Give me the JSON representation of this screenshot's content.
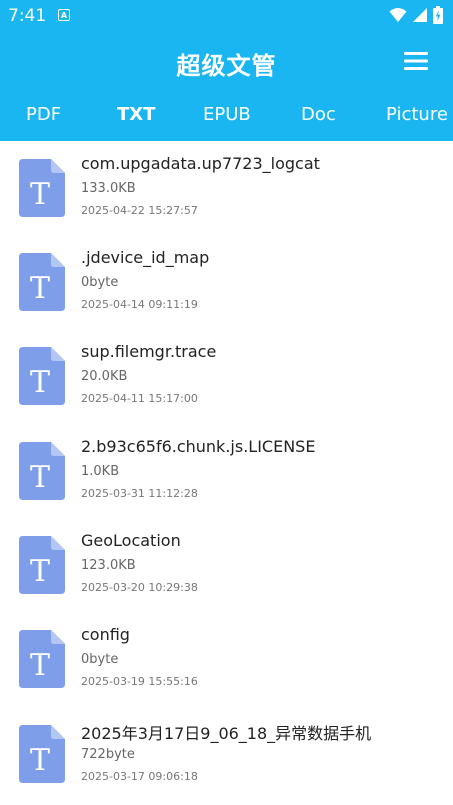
{
  "status": {
    "time": "7:41",
    "badge": "A"
  },
  "header": {
    "title": "超级文管"
  },
  "tabs": [
    {
      "label": "PDF"
    },
    {
      "label": "TXT"
    },
    {
      "label": "EPUB"
    },
    {
      "label": "Doc"
    },
    {
      "label": "Picture"
    }
  ],
  "icons": {
    "file": "txt-file-icon",
    "file_letter": "T",
    "menu": "hamburger-menu-icon"
  },
  "colors": {
    "accent": "#1ab6f1",
    "icon": "#7f9ee9"
  },
  "files": [
    {
      "name": "com.upgadata.up7723_logcat",
      "size": "133.0KB",
      "date": "2025-04-22 15:27:57"
    },
    {
      "name": ".jdevice_id_map",
      "size": "0byte",
      "date": "2025-04-14 09:11:19"
    },
    {
      "name": "sup.filemgr.trace",
      "size": "20.0KB",
      "date": "2025-04-11 15:17:00"
    },
    {
      "name": "2.b93c65f6.chunk.js.LICENSE",
      "size": "1.0KB",
      "date": "2025-03-31 11:12:28"
    },
    {
      "name": "GeoLocation",
      "size": "123.0KB",
      "date": "2025-03-20 10:29:38"
    },
    {
      "name": "config",
      "size": "0byte",
      "date": "2025-03-19 15:55:16"
    },
    {
      "name": "2025年3月17日9_06_18_异常数据手机",
      "size": "722byte",
      "date": "2025-03-17 09:06:18"
    }
  ]
}
